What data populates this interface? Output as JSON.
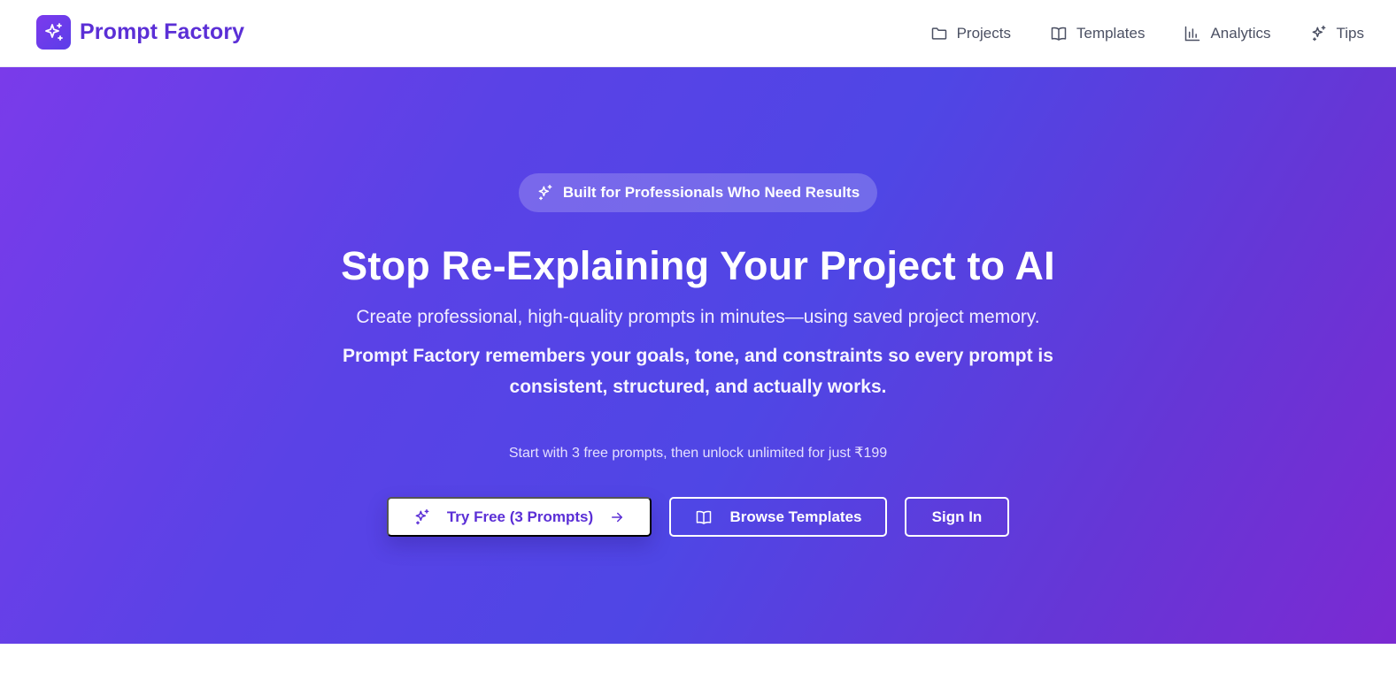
{
  "brand": {
    "name": "Prompt Factory",
    "logo_icon": "sparkles-icon",
    "color": "#5b2fd6"
  },
  "nav": {
    "items": [
      {
        "label": "Projects",
        "icon": "folder-icon"
      },
      {
        "label": "Templates",
        "icon": "book-icon"
      },
      {
        "label": "Analytics",
        "icon": "bar-chart-icon"
      },
      {
        "label": "Tips",
        "icon": "sparkles-icon"
      }
    ]
  },
  "hero": {
    "badge": "Built for Professionals Who Need Results",
    "headline": "Stop Re-Explaining Your Project to AI",
    "subhead": "Create professional, high-quality prompts in minutes—using saved project memory.",
    "subhead_strong": "Prompt Factory remembers your goals, tone, and constraints so every prompt is consistent, structured, and actually works.",
    "pricing_note": "Start with 3 free prompts, then unlock unlimited for just ₹199",
    "gradient_colors": [
      "#7a3bea",
      "#4f46e5",
      "#7b2ad2"
    ]
  },
  "cta": {
    "primary_label": "Try Free (3 Prompts)",
    "browse_label": "Browse Templates",
    "signin_label": "Sign In"
  }
}
